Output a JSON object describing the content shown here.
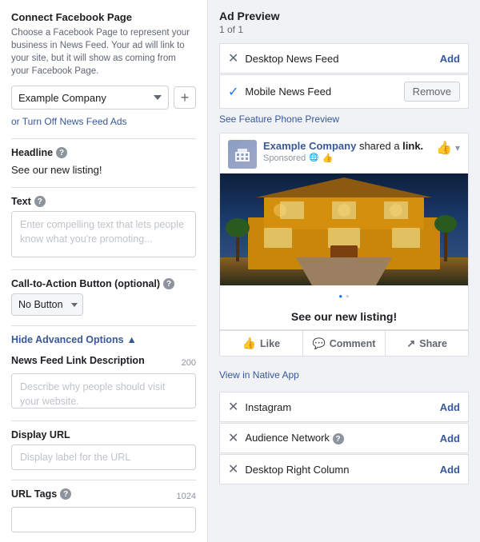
{
  "left": {
    "connect_title": "Connect Facebook Page",
    "connect_desc": "Choose a Facebook Page to represent your business in News Feed. Your ad will link to your site, but it will show as coming from your Facebook Page.",
    "page_select_value": "Example Company",
    "page_select_options": [
      "Example Company"
    ],
    "turn_off_label": "or Turn Off News Feed Ads",
    "headline_label": "Headline",
    "headline_value": "See our new listing!",
    "text_label": "Text",
    "text_placeholder": "Enter compelling text that lets people know what you're promoting...",
    "cta_label": "Call-to-Action Button (optional)",
    "cta_options": [
      "No Button"
    ],
    "cta_value": "No Button",
    "hide_adv_label": "Hide Advanced Options",
    "news_feed_label": "News Feed Link Description",
    "news_feed_char": "200",
    "news_feed_placeholder": "Describe why people should visit your website.",
    "display_url_label": "Display URL",
    "display_url_placeholder": "Display label for the URL",
    "url_tags_label": "URL Tags",
    "url_tags_char": "1024",
    "url_tags_placeholder": ""
  },
  "right": {
    "ad_preview_title": "Ad Preview",
    "ad_preview_count": "1 of 1",
    "placements": [
      {
        "status": "x",
        "label": "Desktop News Feed",
        "action": "Add"
      },
      {
        "status": "check",
        "label": "Mobile News Feed",
        "action": "Remove"
      }
    ],
    "feature_phone_link": "See Feature Phone Preview",
    "ad_card": {
      "company_name": "Example Company",
      "shared_text": "shared a",
      "link_text": "link.",
      "sponsored_text": "Sponsored",
      "cta_text": "See our new listing!",
      "actions": [
        {
          "label": "Like",
          "icon": "thumb"
        },
        {
          "label": "Comment",
          "icon": "comment"
        },
        {
          "label": "Share",
          "icon": "share"
        }
      ]
    },
    "view_native_label": "View in Native App",
    "placements_bottom": [
      {
        "status": "x",
        "label": "Instagram",
        "action": "Add"
      },
      {
        "status": "x",
        "label": "Audience Network",
        "action": "Add",
        "help": true
      },
      {
        "status": "x",
        "label": "Desktop Right Column",
        "action": "Add"
      }
    ]
  }
}
